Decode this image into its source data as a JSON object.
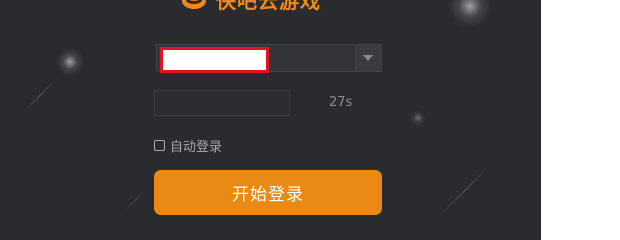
{
  "header": {
    "logo_icon": "cloud-logo-icon",
    "app_title": "快吧云游戏"
  },
  "form": {
    "account_value": "",
    "dropdown_icon": "caret-down-icon",
    "code_value": "",
    "countdown": "27s",
    "auto_login_label": "自动登录",
    "auto_login_checked": false,
    "login_button_label": "开始登录"
  },
  "colors": {
    "background": "#2a2b2f",
    "accent": "#ea8a14",
    "highlight_border": "#e0141e",
    "outside": "#ffffff"
  }
}
